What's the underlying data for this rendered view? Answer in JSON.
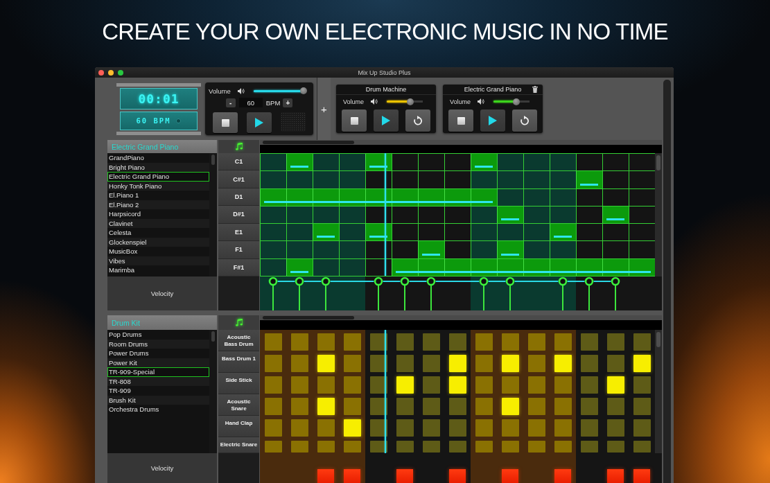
{
  "headline": "CREATE YOUR OWN ELECTRONIC MUSIC IN NO TIME",
  "window": {
    "title": "Mix Up Studio Plus"
  },
  "clock": {
    "time": "00:01",
    "tempo": "60 BPM"
  },
  "master": {
    "volume_label": "Volume",
    "volume": {
      "level": 0.98
    },
    "decrement": "-",
    "bpm": "60",
    "bpm_label": "BPM",
    "increment": "+"
  },
  "add_track": "+",
  "tracks": [
    {
      "title": "Drum Machine",
      "volume_label": "Volume",
      "volume": {
        "level": 0.66
      },
      "color": "#ecc300",
      "deletable": false
    },
    {
      "title": "Electric Grand Piano",
      "volume_label": "Volume",
      "volume": {
        "level": 0.64
      },
      "color": "#3cd41c",
      "deletable": true
    }
  ],
  "sections": [
    {
      "kind": "piano",
      "header": "Electric Grand Piano",
      "presets": [
        {
          "label": "GrandPiano",
          "selected": false
        },
        {
          "label": "Bright Piano",
          "selected": false
        },
        {
          "label": "Electric Grand Piano",
          "selected": true
        },
        {
          "label": "Honky Tonk Piano",
          "selected": false
        },
        {
          "label": "El.Piano 1",
          "selected": false
        },
        {
          "label": "El.Piano 2",
          "selected": false
        },
        {
          "label": "Harpsicord",
          "selected": false
        },
        {
          "label": "Clavinet",
          "selected": false
        },
        {
          "label": "Celesta",
          "selected": false
        },
        {
          "label": "Glockenspiel",
          "selected": false
        },
        {
          "label": "MusicBox",
          "selected": false
        },
        {
          "label": "Vibes",
          "selected": false
        },
        {
          "label": "Marimba",
          "selected": false
        }
      ],
      "lanes": [
        {
          "label": "C1",
          "steps": [
            false,
            true,
            false,
            false,
            true,
            false,
            false,
            false,
            true,
            false,
            false,
            false,
            false,
            false,
            false
          ]
        },
        {
          "label": "C#1",
          "steps": [
            false,
            false,
            false,
            false,
            false,
            false,
            false,
            false,
            false,
            false,
            false,
            false,
            true,
            false,
            false
          ]
        },
        {
          "label": "D1",
          "steps": [
            true,
            true,
            true,
            true,
            true,
            true,
            true,
            true,
            true,
            false,
            false,
            false,
            false,
            false,
            false
          ]
        },
        {
          "label": "D#1",
          "steps": [
            false,
            false,
            false,
            false,
            false,
            false,
            false,
            false,
            false,
            true,
            false,
            false,
            false,
            true,
            false
          ]
        },
        {
          "label": "E1",
          "steps": [
            false,
            false,
            true,
            false,
            true,
            false,
            false,
            false,
            false,
            false,
            false,
            true,
            false,
            false,
            false
          ]
        },
        {
          "label": "F1",
          "steps": [
            false,
            false,
            false,
            false,
            false,
            false,
            true,
            false,
            false,
            true,
            false,
            false,
            false,
            false,
            false
          ]
        },
        {
          "label": "F#1",
          "steps": [
            false,
            true,
            false,
            false,
            false,
            true,
            true,
            true,
            true,
            true,
            true,
            true,
            true,
            true,
            true
          ]
        }
      ],
      "playhead": {
        "level": 0.318
      },
      "velocity_label": "Velocity"
    },
    {
      "kind": "drums",
      "header": "Drum Kit",
      "presets": [
        {
          "label": "Pop Drums",
          "selected": false
        },
        {
          "label": "Room Drums",
          "selected": false
        },
        {
          "label": "Power Drums",
          "selected": false
        },
        {
          "label": "Power Kit",
          "selected": false
        },
        {
          "label": "TR-909-Special",
          "selected": true
        },
        {
          "label": "TR-808",
          "selected": false
        },
        {
          "label": "TR-909",
          "selected": false
        },
        {
          "label": "Brush Kit",
          "selected": false
        },
        {
          "label": "Orchestra Drums",
          "selected": false
        }
      ],
      "lanes": [
        {
          "label": "Acoustic Bass Drum",
          "steps": [
            false,
            false,
            false,
            false,
            false,
            false,
            false,
            false,
            false,
            false,
            false,
            false,
            false,
            false,
            false
          ]
        },
        {
          "label": "Bass Drum 1",
          "steps": [
            false,
            false,
            true,
            false,
            false,
            false,
            false,
            true,
            false,
            true,
            false,
            true,
            false,
            false,
            true
          ]
        },
        {
          "label": "Side Stick",
          "steps": [
            false,
            false,
            false,
            false,
            false,
            true,
            false,
            true,
            false,
            false,
            false,
            false,
            false,
            true,
            false
          ]
        },
        {
          "label": "Acoustic Snare",
          "steps": [
            false,
            false,
            true,
            false,
            false,
            false,
            false,
            false,
            false,
            true,
            false,
            false,
            false,
            false,
            false
          ]
        },
        {
          "label": "Hand Clap",
          "steps": [
            false,
            false,
            false,
            true,
            false,
            false,
            false,
            false,
            false,
            false,
            false,
            false,
            false,
            false,
            false
          ]
        },
        {
          "label": "Electric Snare",
          "steps": [
            false,
            false,
            false,
            false,
            false,
            false,
            false,
            false,
            false,
            false,
            false,
            false,
            false,
            false,
            false
          ]
        }
      ],
      "playhead": {
        "level": 0.318
      },
      "velocity_label": "Velocity"
    }
  ]
}
